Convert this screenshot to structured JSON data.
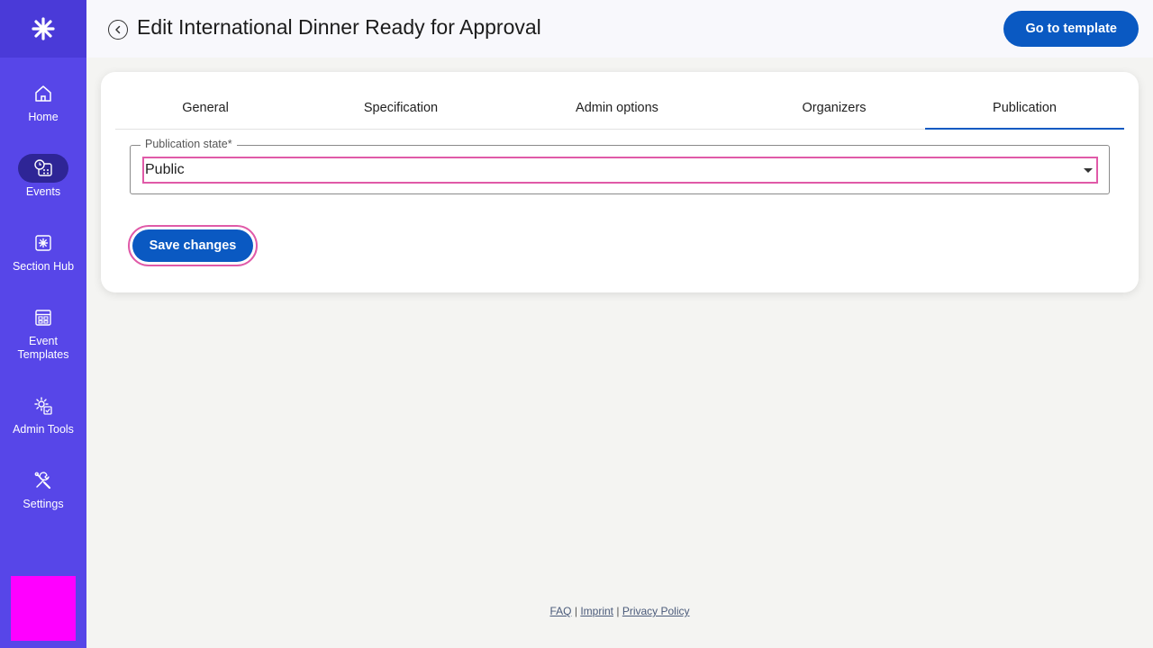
{
  "header": {
    "title": "Edit International Dinner Ready for Approval",
    "go_to_template": "Go to template"
  },
  "sidebar": {
    "items": [
      {
        "label": "Home",
        "icon": "home-icon"
      },
      {
        "label": "Events",
        "icon": "events-icon",
        "active": true
      },
      {
        "label": "Section Hub",
        "icon": "section-hub-icon"
      },
      {
        "label": "Event Templates",
        "icon": "templates-icon"
      },
      {
        "label": "Admin Tools",
        "icon": "admin-tools-icon"
      },
      {
        "label": "Settings",
        "icon": "settings-icon"
      }
    ]
  },
  "tabs": [
    {
      "label": "General"
    },
    {
      "label": "Specification"
    },
    {
      "label": "Admin options"
    },
    {
      "label": "Organizers"
    },
    {
      "label": "Publication",
      "active": true
    }
  ],
  "form": {
    "publication_state_label": "Publication state",
    "required_marker": "*",
    "publication_state_value": "Public",
    "save_label": "Save changes"
  },
  "footer": {
    "faq": "FAQ",
    "separator": "|",
    "imprint": "Imprint",
    "privacy": "Privacy Policy"
  },
  "colors": {
    "sidebar": "#5746e8",
    "primary": "#0a59c2",
    "focus_outline": "#e05aa8",
    "avatar": "#ff00ff"
  }
}
